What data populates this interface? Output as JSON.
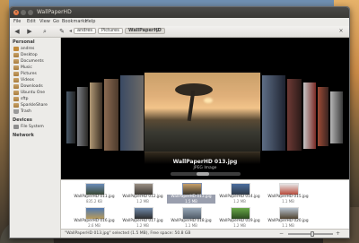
{
  "window": {
    "title": "WallPaperHD",
    "buttons": {
      "close": "×",
      "minimize": "",
      "maximize": ""
    }
  },
  "menubar": [
    "File",
    "Edit",
    "View",
    "Go",
    "Bookmarks",
    "Help"
  ],
  "toolbar": {
    "back": "◀",
    "forward": "▶",
    "search": "⌕",
    "edit_path": "✎",
    "breadcrumbs": [
      "andres",
      "Pictures",
      "WallPaperHD"
    ]
  },
  "sidebar": {
    "sections": [
      {
        "title": "Personal",
        "items": [
          {
            "label": "andres",
            "icon": "home-icon"
          },
          {
            "label": "Desktop",
            "icon": "folder-icon"
          },
          {
            "label": "Documents",
            "icon": "folder-icon"
          },
          {
            "label": "Music",
            "icon": "folder-icon"
          },
          {
            "label": "Pictures",
            "icon": "folder-icon"
          },
          {
            "label": "Videos",
            "icon": "folder-icon"
          },
          {
            "label": "Downloads",
            "icon": "folder-icon"
          },
          {
            "label": "Ubuntu One",
            "icon": "folder-icon"
          },
          {
            "label": "sftp",
            "icon": "folder-icon"
          },
          {
            "label": "SparkleShare",
            "icon": "folder-icon"
          },
          {
            "label": "Trash",
            "icon": "trash-icon"
          }
        ]
      },
      {
        "title": "Devices",
        "items": [
          {
            "label": "File System",
            "icon": "disk-icon"
          }
        ]
      },
      {
        "title": "Network",
        "items": []
      }
    ]
  },
  "coverflow": {
    "caption": "WallPaperHD 013.jpg",
    "subcaption": "JPEG Image",
    "scroll_position": 0.45
  },
  "files": [
    {
      "name": "WallPaperHD 011.jpg",
      "size": "835.2 KB",
      "colors": [
        "#6b8cb8",
        "#3b4a35"
      ],
      "selected": false
    },
    {
      "name": "WallPaperHD 012.jpg",
      "size": "1.2 MB",
      "colors": [
        "#9a8f84",
        "#3e3a34"
      ],
      "selected": false
    },
    {
      "name": "WallPaperHD 013.jpg",
      "size": "1.5 MB",
      "colors": [
        "#c7a06a",
        "#3a362e"
      ],
      "selected": true
    },
    {
      "name": "WallPaperHD 014.jpg",
      "size": "1.2 MB",
      "colors": [
        "#4c6fa0",
        "#2f3a48"
      ],
      "selected": false
    },
    {
      "name": "WallPaperHD 015.jpg",
      "size": "1.1 MB",
      "colors": [
        "#e7e7e7",
        "#b84a3a"
      ],
      "selected": false
    },
    {
      "name": "WallPaperHD 016.jpg",
      "size": "2.6 MB",
      "colors": [
        "#4f79b2",
        "#b89b5a"
      ],
      "selected": false
    },
    {
      "name": "WallPaperHD 017.jpg",
      "size": "1.2 MB",
      "colors": [
        "#6f88a8",
        "#2d2d2d"
      ],
      "selected": false
    },
    {
      "name": "WallPaperHD 018.jpg",
      "size": "1.1 MB",
      "colors": [
        "#96a6b6",
        "#4f5a66"
      ],
      "selected": false
    },
    {
      "name": "WallPaperHD 019.jpg",
      "size": "1.2 MB",
      "colors": [
        "#68a848",
        "#2a4a1e"
      ],
      "selected": false
    },
    {
      "name": "WallPaperHD 020.jpg",
      "size": "1.1 MB",
      "colors": [
        "#b4c0cc",
        "#51432f"
      ],
      "selected": false
    }
  ],
  "status": {
    "text": "\"WallPaperHD 013.jpg\" selected (1.5 MB), Free space: 50.8 GB",
    "zoom_minus": "−",
    "zoom_plus": "+",
    "zoom_level": 0.55
  }
}
